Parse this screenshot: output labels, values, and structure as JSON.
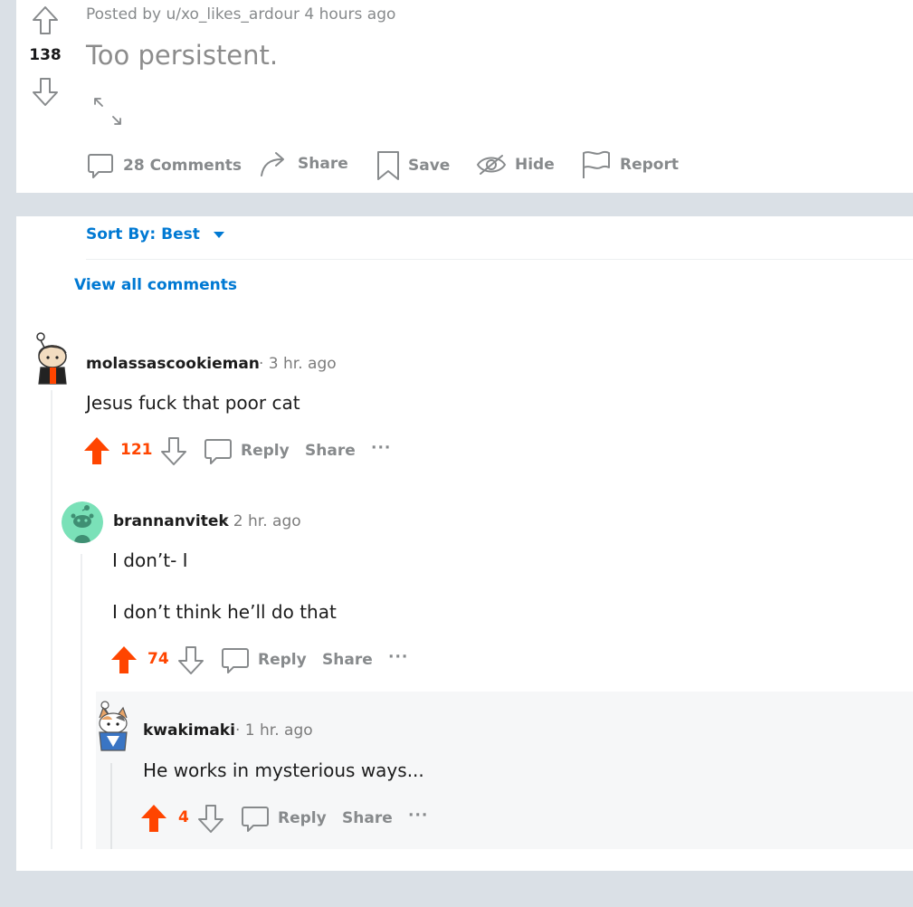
{
  "post": {
    "meta": "Posted by u/xo_likes_ardour 4 hours ago",
    "score": "138",
    "title": "Too persistent.",
    "actions": {
      "comments": "28 Comments",
      "share": "Share",
      "save": "Save",
      "hide": "Hide",
      "report": "Report"
    }
  },
  "comments_section": {
    "sort_label": "Sort By: Best",
    "view_all": "View all comments"
  },
  "comments": [
    {
      "username": "molassascookieman",
      "time": "· 3 hr. ago",
      "body": [
        "Jesus fuck that poor cat"
      ],
      "votes": "121",
      "reply": "Reply",
      "share": "Share",
      "more": "···"
    },
    {
      "username": "brannanvitek",
      "time": "· 2 hr. ago",
      "body": [
        "I don’t- I",
        "I don’t think he’ll do that"
      ],
      "votes": "74",
      "reply": "Reply",
      "share": "Share",
      "more": "···"
    },
    {
      "username": "kwakimaki",
      "time": "· 1 hr. ago",
      "body": [
        "He works in mysterious ways..."
      ],
      "votes": "4",
      "reply": "Reply",
      "share": "Share",
      "more": "···"
    }
  ],
  "colors": {
    "upvoted": "#ff4500",
    "link_blue": "#0079d3",
    "muted": "#878a8c"
  }
}
